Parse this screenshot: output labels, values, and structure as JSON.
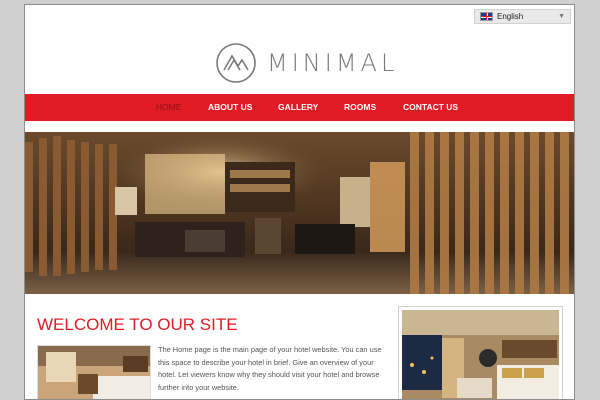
{
  "language": {
    "selected": "English",
    "flag_icon": "uk-flag-icon"
  },
  "logo": {
    "text": "MINIMAL",
    "mark_icon": "mountain-circle-logo-icon"
  },
  "nav": {
    "items": [
      {
        "label": "HOME",
        "active": true
      },
      {
        "label": "ABOUT US",
        "active": false
      },
      {
        "label": "GALLERY",
        "active": false
      },
      {
        "label": "ROOMS",
        "active": false
      },
      {
        "label": "CONTACT US",
        "active": false
      }
    ]
  },
  "welcome": {
    "title": "WELCOME TO OUR SITE",
    "body": "The Home page is the main page of your hotel website. You can use this space to describe your hotel in brief. Give an overview of your hotel. Let viewers know why they should visit your hotel and browse further into your website."
  },
  "colors": {
    "accent": "#e01b24",
    "nav_active_text": "#8f1015",
    "text": "#555555"
  }
}
